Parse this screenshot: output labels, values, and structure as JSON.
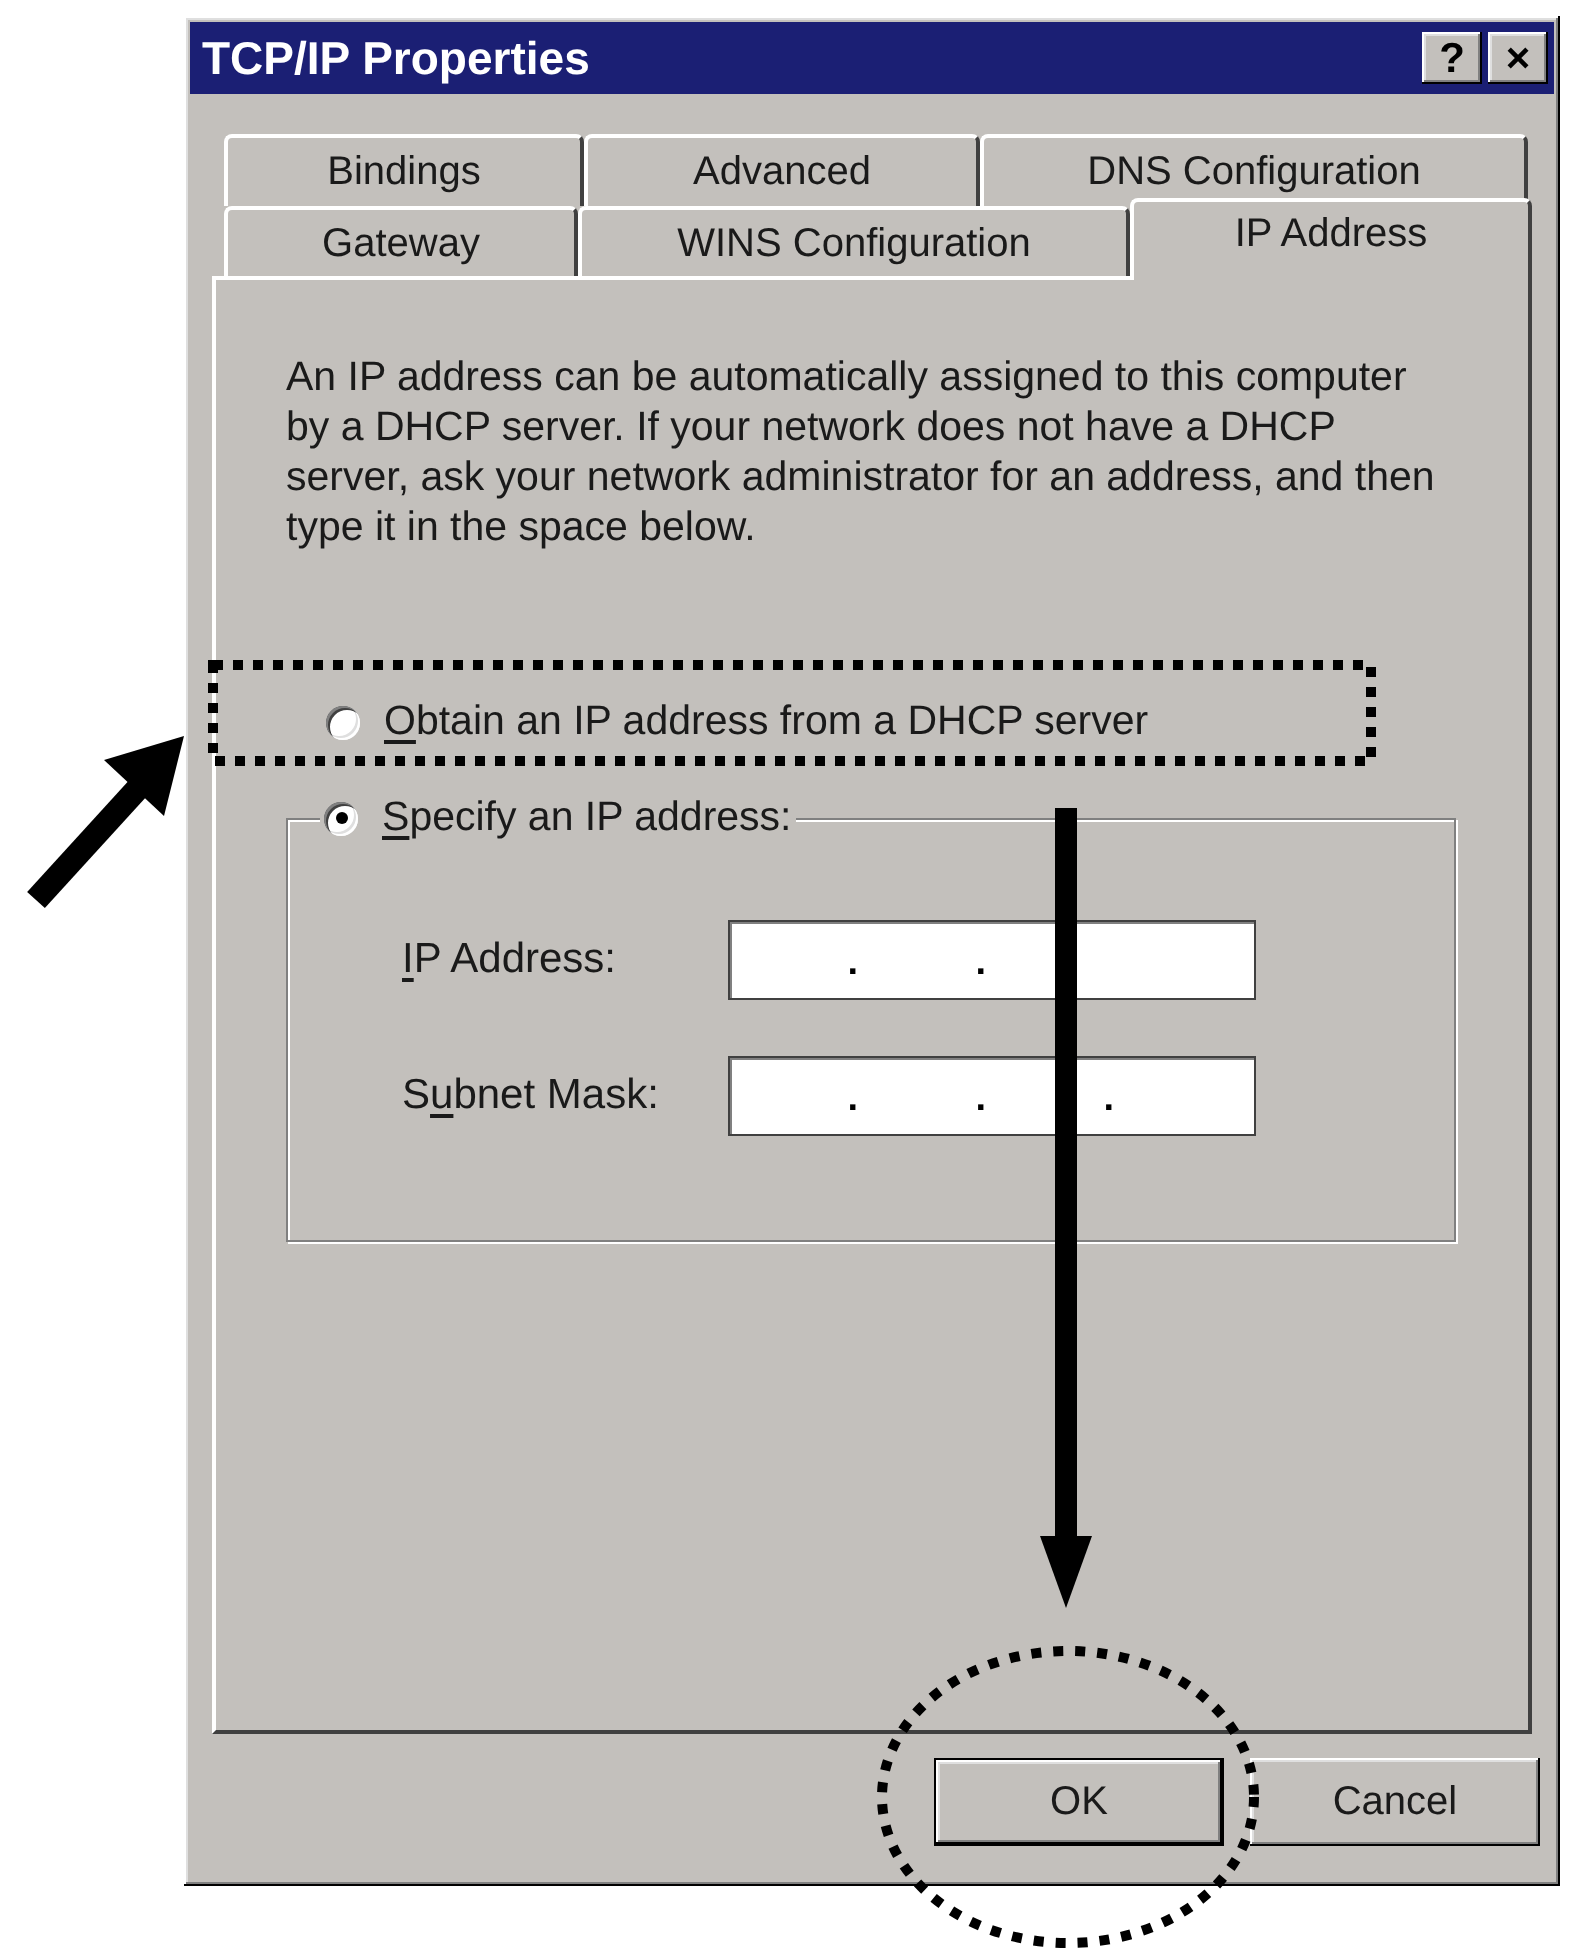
{
  "window": {
    "title": "TCP/IP Properties",
    "title_buttons": [
      "?",
      "×"
    ]
  },
  "tab_rows": [
    [
      {
        "label": "Bindings",
        "selected": false
      },
      {
        "label": "Advanced",
        "selected": false
      },
      {
        "label": "DNS Configuration",
        "selected": false
      }
    ],
    [
      {
        "label": "Gateway",
        "selected": false
      },
      {
        "label": "WINS Configuration",
        "selected": false
      },
      {
        "label": "IP Address",
        "selected": true
      }
    ]
  ],
  "description_lines": [
    "An IP address can be automatically assigned to this computer",
    "by a DHCP server. If your network does not have a DHCP",
    "server, ask your network administrator for an address, and then",
    "type it in the space below."
  ],
  "options": [
    {
      "kind": "plain",
      "label": {
        "key": "O",
        "after": "btain an IP address from a DHCP server"
      },
      "selected": false
    },
    {
      "kind": "group",
      "label": {
        "key": "S",
        "after": "pecify an IP address:"
      },
      "selected": true,
      "fields": [
        {
          "label": {
            "key": "I",
            "after": "P Address:"
          },
          "separators": [
            ".",
            "."
          ]
        },
        {
          "label": {
            "before": "S",
            "key": "u",
            "after": "bnet Mask:"
          },
          "separators": [
            ".",
            ".",
            "."
          ]
        }
      ]
    }
  ],
  "buttons": [
    {
      "label": "OK",
      "default": true
    },
    {
      "label": "Cancel",
      "default": false
    }
  ]
}
